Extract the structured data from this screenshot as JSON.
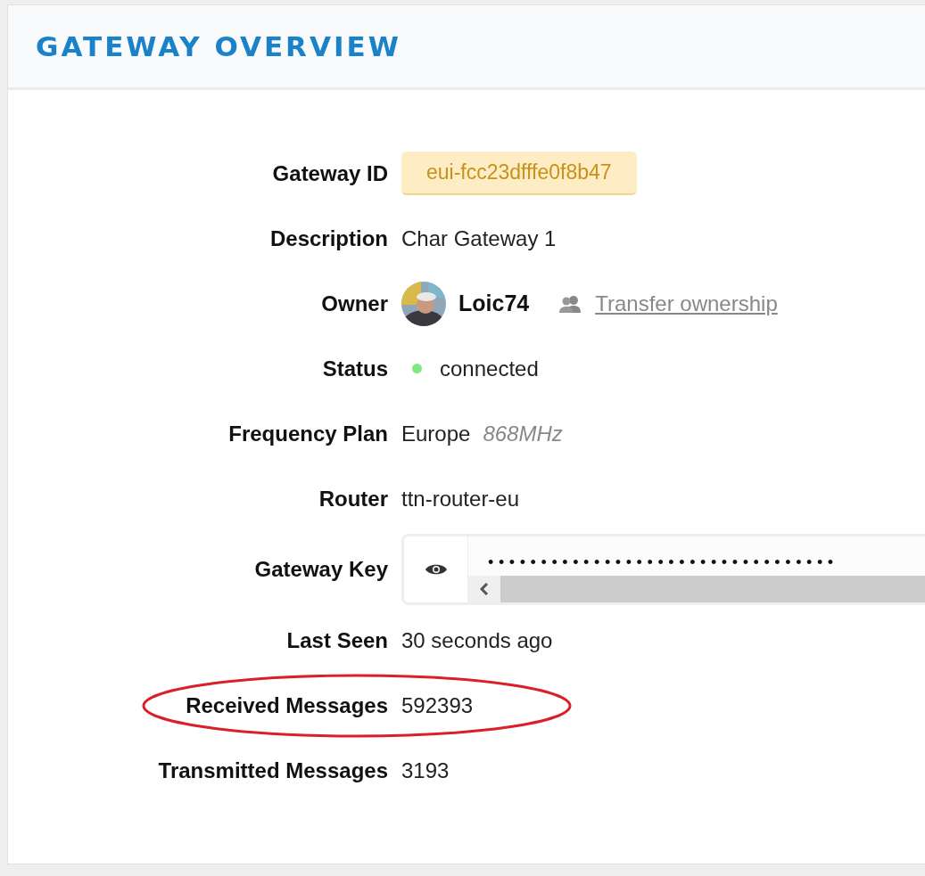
{
  "header": {
    "title": "GATEWAY OVERVIEW"
  },
  "rows": [
    {
      "kind": "badge",
      "label": "Gateway ID",
      "value": "eui-fcc23dfffe0f8b47"
    },
    {
      "kind": "text",
      "label": "Description",
      "value": "Char Gateway 1"
    },
    {
      "kind": "owner",
      "label": "Owner",
      "value": "Loic74",
      "link": "Transfer ownership"
    },
    {
      "kind": "status",
      "label": "Status",
      "value": "connected",
      "color": "#7fe87f"
    },
    {
      "kind": "frequency",
      "label": "Frequency Plan",
      "value": "Europe",
      "detail": "868MHz"
    },
    {
      "kind": "text",
      "label": "Router",
      "value": "ttn-router-eu"
    },
    {
      "kind": "key",
      "label": "Gateway Key",
      "value": "•••••••••••••••••••••••••••••••••"
    },
    {
      "kind": "text",
      "label": "Last Seen",
      "value": "30 seconds ago"
    },
    {
      "kind": "text",
      "label": "Received Messages",
      "value": "592393",
      "highlighted": true
    },
    {
      "kind": "text",
      "label": "Transmitted Messages",
      "value": "3193"
    }
  ]
}
